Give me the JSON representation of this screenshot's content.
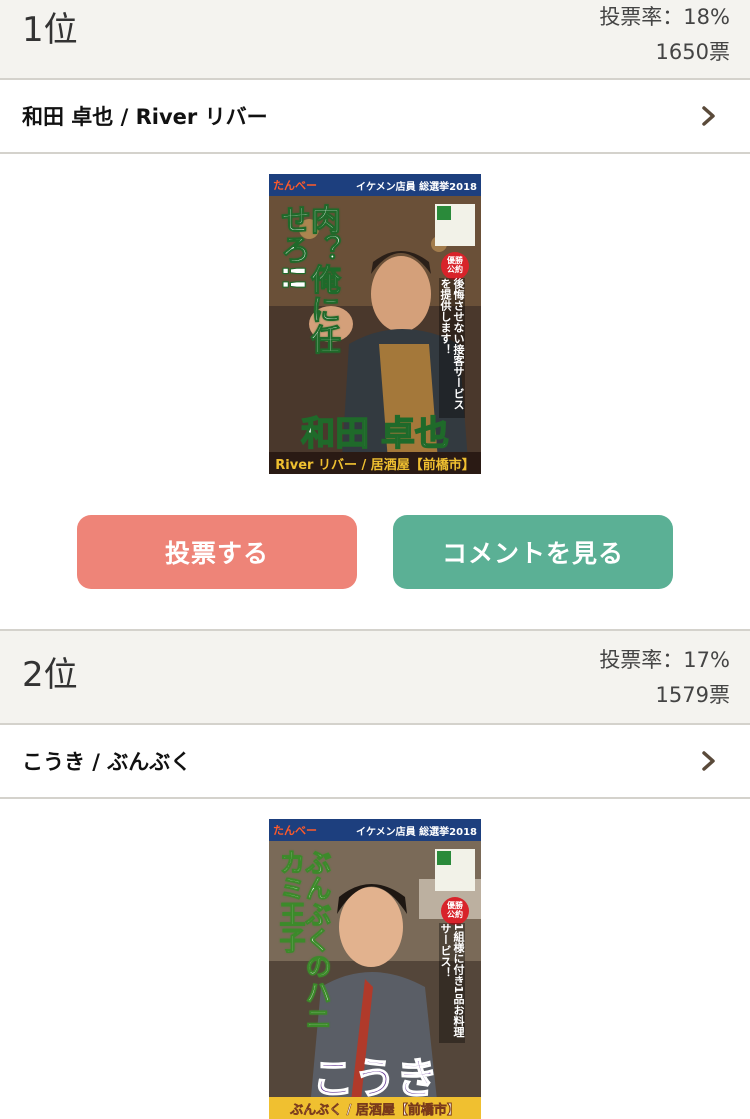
{
  "entries": [
    {
      "rank": "1位",
      "vote_rate": "投票率：18%",
      "vote_count": "1650票",
      "name": "和田 卓也 / River リバー",
      "poster": {
        "logo": "たんべー",
        "campaign": "イケメン店員 総選挙2018",
        "catchphrase": "肉？俺に任せろ!!",
        "pledge_badge": "優勝公約",
        "pledge": "後悔させない接客サービスを提供します！",
        "display_name": "和田 卓也",
        "shop": "River リバー / 居酒屋【前橋市】"
      },
      "vote_button": "投票する",
      "comment_button": "コメントを見る"
    },
    {
      "rank": "2位",
      "vote_rate": "投票率：17%",
      "vote_count": "1579票",
      "name": "こうき / ぶんぶく",
      "poster": {
        "logo": "たんべー",
        "campaign": "イケメン店員 総選挙2018",
        "catchphrase": "ぶんぶくのハニカミ王子",
        "pledge_badge": "優勝公約",
        "pledge": "1組様に付き1品お料理サービス！",
        "display_name": "こうき",
        "shop": "ぶんぶく / 居酒屋【前橋市】"
      }
    }
  ],
  "icons": {
    "chevron": "chevron-right-icon"
  },
  "colors": {
    "vote_button": "#ee8478",
    "comment_button": "#5bb095",
    "header_bg": "#f4f3ef"
  }
}
